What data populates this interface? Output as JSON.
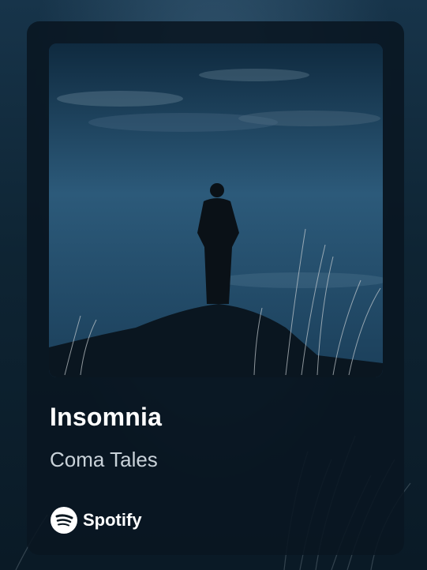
{
  "track": {
    "title": "Insomnia",
    "artist": "Coma Tales"
  },
  "brand": {
    "name": "Spotify",
    "icon": "spotify-logo-icon"
  },
  "colors": {
    "background": "#0b1c2a",
    "card": "#09161f",
    "title": "#ffffff",
    "artist": "#c9d2d9"
  },
  "artwork": {
    "description_icon": "album-artwork"
  }
}
